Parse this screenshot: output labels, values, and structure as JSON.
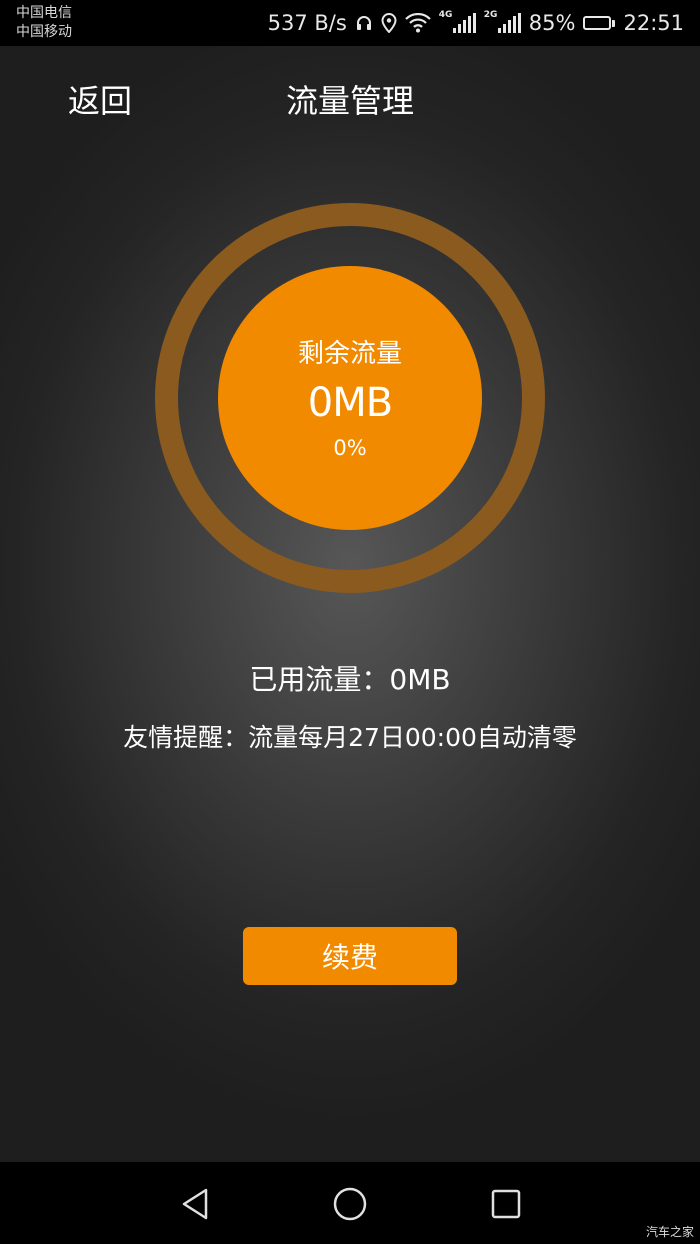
{
  "status_bar": {
    "carrier_1": "中国电信",
    "carrier_2": "中国移动",
    "network_speed": "537 B/s",
    "signal_1_tag": "4G",
    "signal_2_tag": "2G",
    "battery_percent": "85%",
    "battery_level": 0.85,
    "time": "22:51",
    "icons": [
      "headphones-icon",
      "location-icon",
      "wifi-icon",
      "signal-icon",
      "battery-icon"
    ]
  },
  "header": {
    "back_label": "返回",
    "title": "流量管理"
  },
  "gauge": {
    "label": "剩余流量",
    "value": "0MB",
    "percent": "0%",
    "accent_color": "#f28a00",
    "ring_color": "#8a5a1f"
  },
  "info": {
    "used": "已用流量：0MB",
    "reminder": "友情提醒：流量每月27日00:00自动清零"
  },
  "actions": {
    "renew_label": "续费"
  },
  "nav_bar": {
    "icons": [
      "back-triangle-icon",
      "home-circle-icon",
      "recents-square-icon"
    ]
  },
  "watermark": "汽车之家"
}
